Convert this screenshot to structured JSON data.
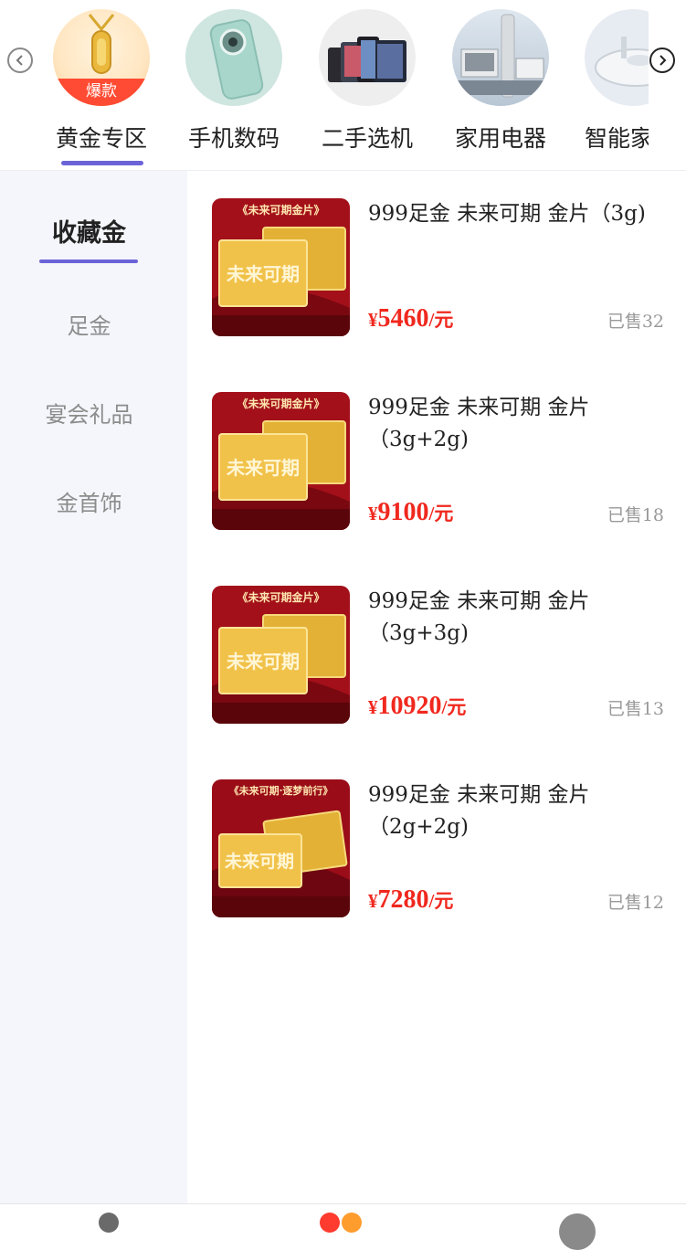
{
  "categories": [
    {
      "label": "黄金专区",
      "badge": "爆款",
      "active": true,
      "icon": "gold-pendant-image"
    },
    {
      "label": "手机数码",
      "icon": "phone-image"
    },
    {
      "label": "二手选机",
      "icon": "devices-image"
    },
    {
      "label": "家用电器",
      "icon": "appliance-image"
    },
    {
      "label": "智能家",
      "icon": "robot-vacuum-image"
    }
  ],
  "sidebar": {
    "items": [
      {
        "label": "收藏金",
        "active": true
      },
      {
        "label": "足金"
      },
      {
        "label": "宴会礼品"
      },
      {
        "label": "金首饰"
      }
    ]
  },
  "products": [
    {
      "title": "999足金 未来可期 金片（3g)",
      "price_symbol": "¥",
      "price": "5460",
      "price_unit": "/元",
      "sold": "已售32",
      "image_banner": "《未来可期金片》"
    },
    {
      "title": "999足金 未来可期 金片（3g+2g)",
      "price_symbol": "¥",
      "price": "9100",
      "price_unit": "/元",
      "sold": "已售18",
      "image_banner": "《未来可期金片》"
    },
    {
      "title": "999足金 未来可期 金片（3g+3g)",
      "price_symbol": "¥",
      "price": "10920",
      "price_unit": "/元",
      "sold": "已售13",
      "image_banner": "《未来可期金片》"
    },
    {
      "title": "999足金 未来可期 金片（2g+2g)",
      "price_symbol": "¥",
      "price": "7280",
      "price_unit": "/元",
      "sold": "已售12",
      "image_banner": "《未来可期·逐梦前行》"
    }
  ],
  "colors": {
    "accent": "#6c63d8",
    "price": "#f0281e",
    "badge": "#ff4b33",
    "sidebar_bg": "#f5f6fb"
  }
}
